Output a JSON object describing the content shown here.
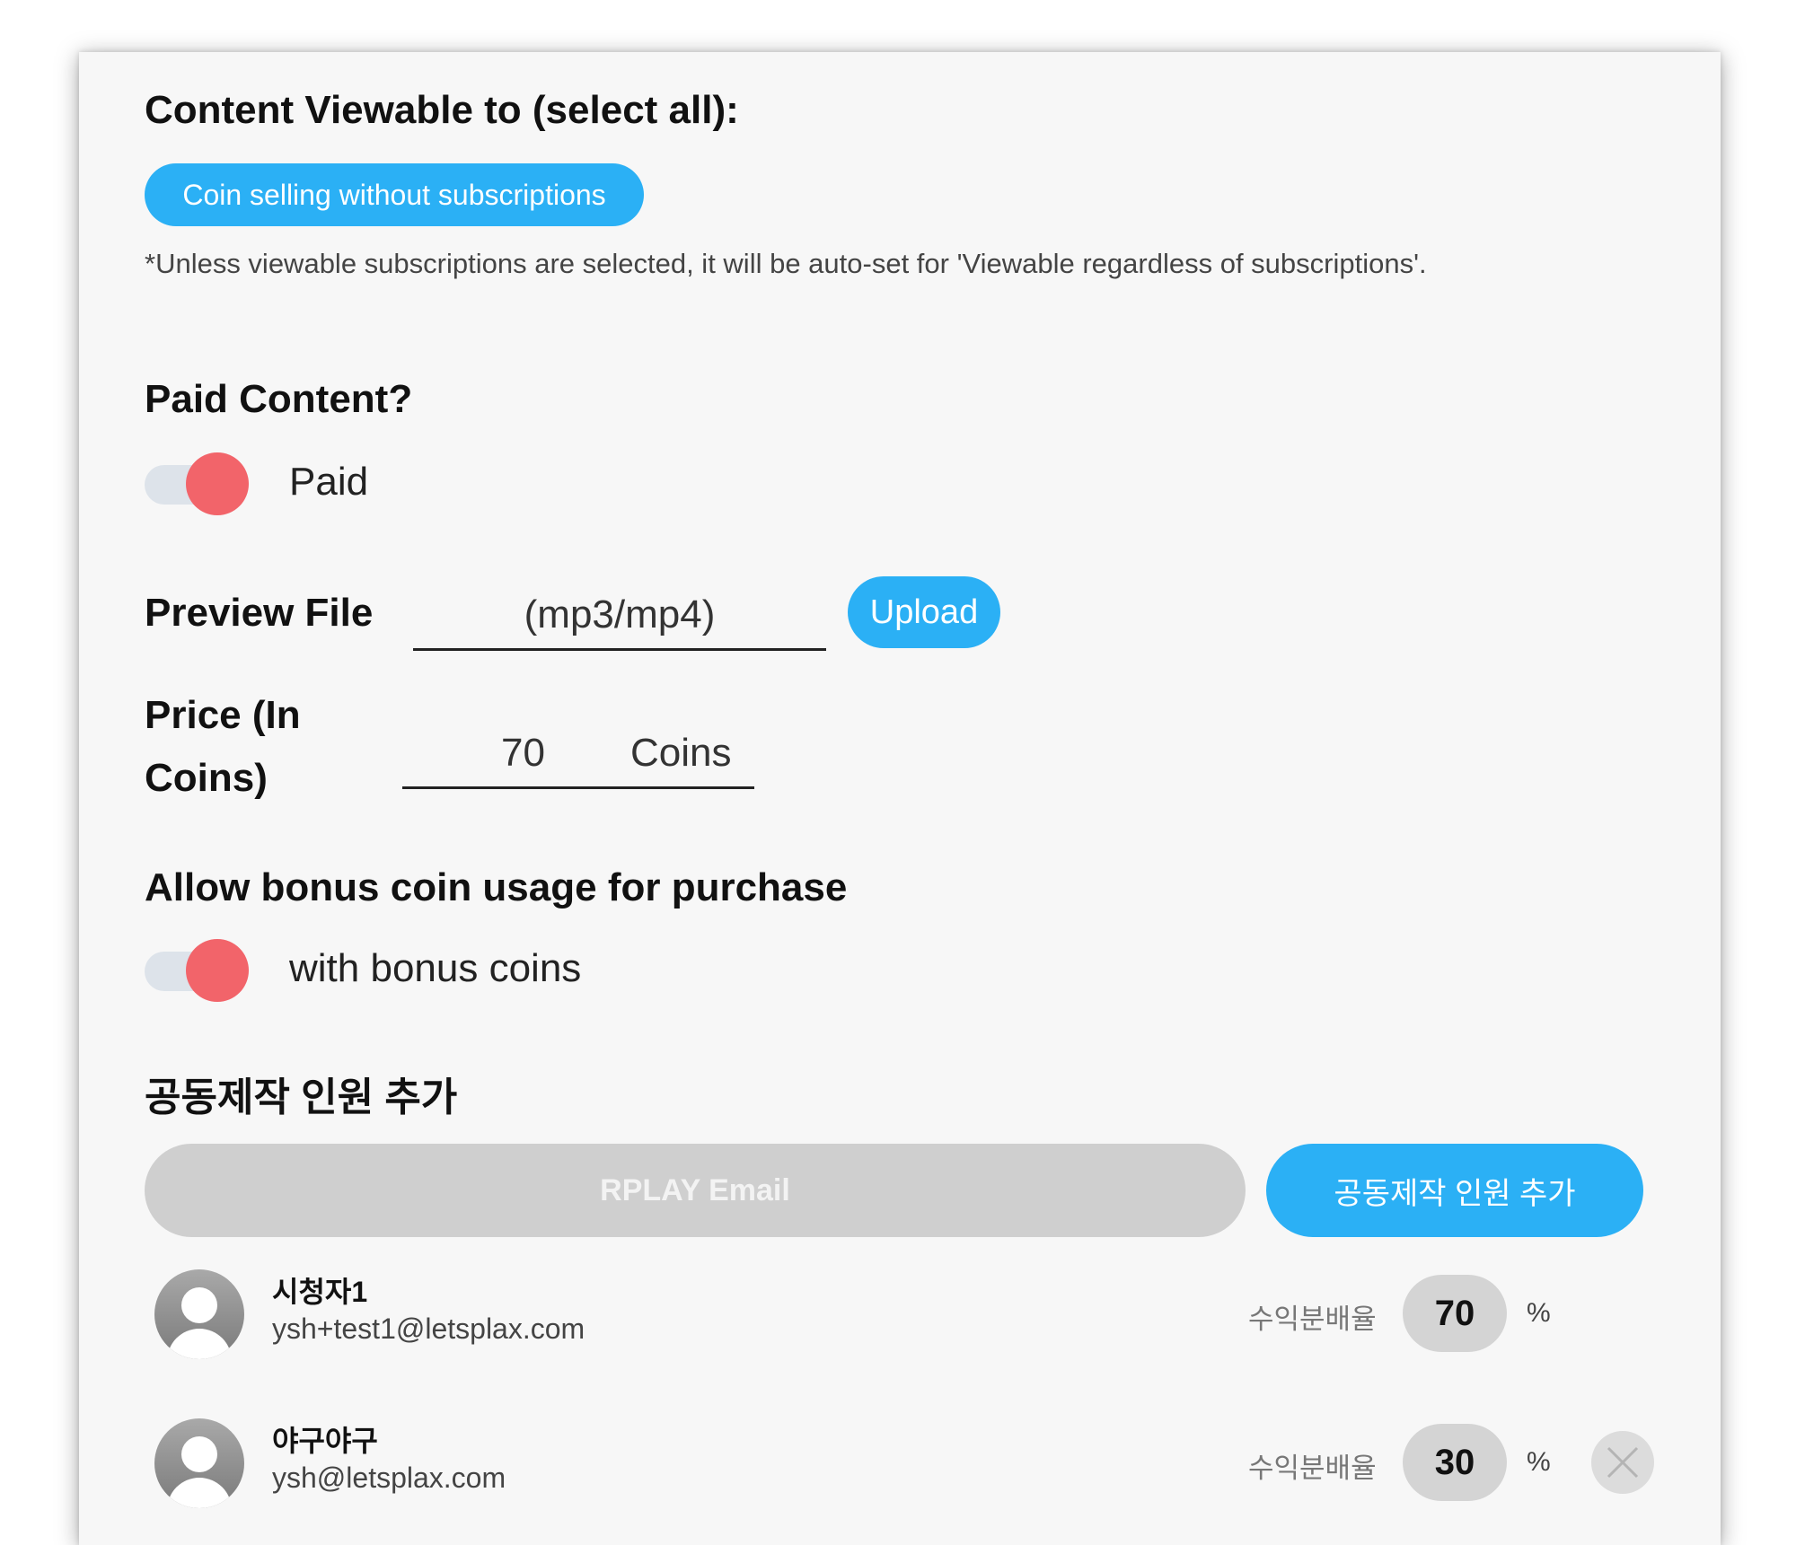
{
  "viewable": {
    "heading": "Content Viewable to (select all):",
    "chip_label": "Coin selling without subscriptions",
    "note": "*Unless viewable subscriptions are selected, it will be auto-set for 'Viewable regardless of subscriptions'."
  },
  "paid": {
    "heading": "Paid Content?",
    "toggle_on": true,
    "toggle_label": "Paid"
  },
  "preview": {
    "label": "Preview File",
    "placeholder": "(mp3/mp4)",
    "upload_label": "Upload"
  },
  "price": {
    "label_line1": "Price (In",
    "label_line2": "Coins)",
    "value": "70",
    "unit": "Coins"
  },
  "bonus": {
    "heading": "Allow bonus coin usage for purchase",
    "toggle_on": true,
    "toggle_label": "with bonus coins"
  },
  "coproducers": {
    "heading": "공동제작 인원 추가",
    "email_placeholder": "RPLAY Email",
    "add_button_label": "공동제작 인원 추가",
    "share_label": "수익분배율",
    "percent_symbol": "%",
    "members": [
      {
        "name": "시청자1",
        "email": "ysh+test1@letsplax.com",
        "share": "70"
      },
      {
        "name": "야구야구",
        "email": "ysh@letsplax.com",
        "share": "30"
      }
    ]
  },
  "colors": {
    "accent_blue": "#2bb0f5",
    "toggle_red": "#f2646a"
  }
}
